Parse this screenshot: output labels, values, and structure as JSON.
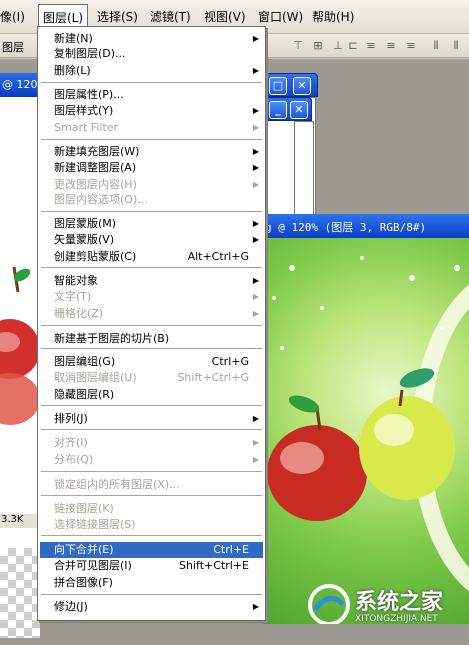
{
  "menubar": {
    "items": [
      "像(I)",
      "图层(L)",
      "选择(S)",
      "滤镜(T)",
      "视图(V)",
      "窗口(W)",
      "帮助(H)"
    ]
  },
  "optbar": {
    "label": "图层"
  },
  "docs": {
    "left_title": "@ 120",
    "left_status": "3.3K",
    "main_title": "g @ 120% (图层 3, RGB/8#)"
  },
  "layer_menu": {
    "items": [
      {
        "label": "新建(N)",
        "sc": "",
        "sub": true,
        "disabled": false
      },
      {
        "label": "复制图层(D)...",
        "sc": "",
        "sub": false,
        "disabled": false
      },
      {
        "label": "删除(L)",
        "sc": "",
        "sub": true,
        "disabled": false
      },
      {
        "label": "图层属性(P)...",
        "sc": "",
        "sub": false,
        "disabled": false
      },
      {
        "label": "图层样式(Y)",
        "sc": "",
        "sub": true,
        "disabled": false
      },
      {
        "label": "Smart Filter",
        "sc": "",
        "sub": true,
        "disabled": true
      },
      {
        "label": "新建填充图层(W)",
        "sc": "",
        "sub": true,
        "disabled": false
      },
      {
        "label": "新建调整图层(A)",
        "sc": "",
        "sub": true,
        "disabled": false
      },
      {
        "label": "更改图层内容(H)",
        "sc": "",
        "sub": true,
        "disabled": true
      },
      {
        "label": "图层内容选项(O)...",
        "sc": "",
        "sub": false,
        "disabled": true
      },
      {
        "label": "图层蒙版(M)",
        "sc": "",
        "sub": true,
        "disabled": false
      },
      {
        "label": "矢量蒙版(V)",
        "sc": "",
        "sub": true,
        "disabled": false
      },
      {
        "label": "创建剪贴蒙版(C)",
        "sc": "Alt+Ctrl+G",
        "sub": false,
        "disabled": false
      },
      {
        "label": "智能对象",
        "sc": "",
        "sub": true,
        "disabled": false
      },
      {
        "label": "文字(T)",
        "sc": "",
        "sub": true,
        "disabled": true
      },
      {
        "label": "栅格化(Z)",
        "sc": "",
        "sub": true,
        "disabled": true
      },
      {
        "label": "新建基于图层的切片(B)",
        "sc": "",
        "sub": false,
        "disabled": false
      },
      {
        "label": "图层编组(G)",
        "sc": "Ctrl+G",
        "sub": false,
        "disabled": false
      },
      {
        "label": "取消图层编组(U)",
        "sc": "Shift+Ctrl+G",
        "sub": false,
        "disabled": true
      },
      {
        "label": "隐藏图层(R)",
        "sc": "",
        "sub": false,
        "disabled": false
      },
      {
        "label": "排列(J)",
        "sc": "",
        "sub": true,
        "disabled": false
      },
      {
        "label": "对齐(I)",
        "sc": "",
        "sub": true,
        "disabled": true
      },
      {
        "label": "分布(Q)",
        "sc": "",
        "sub": true,
        "disabled": true
      },
      {
        "label": "锁定组内的所有图层(X)...",
        "sc": "",
        "sub": false,
        "disabled": true
      },
      {
        "label": "链接图层(K)",
        "sc": "",
        "sub": false,
        "disabled": true
      },
      {
        "label": "选择链接图层(S)",
        "sc": "",
        "sub": false,
        "disabled": true
      },
      {
        "label": "向下合并(E)",
        "sc": "Ctrl+E",
        "sub": false,
        "disabled": false,
        "selected": true
      },
      {
        "label": "合并可见图层(I)",
        "sc": "Shift+Ctrl+E",
        "sub": false,
        "disabled": false
      },
      {
        "label": "拼合图像(F)",
        "sc": "",
        "sub": false,
        "disabled": false
      },
      {
        "label": "修边(J)",
        "sc": "",
        "sub": true,
        "disabled": false
      }
    ]
  },
  "watermark": {
    "text": "系统之家",
    "url": "XITONGZHIJIA.NET"
  }
}
